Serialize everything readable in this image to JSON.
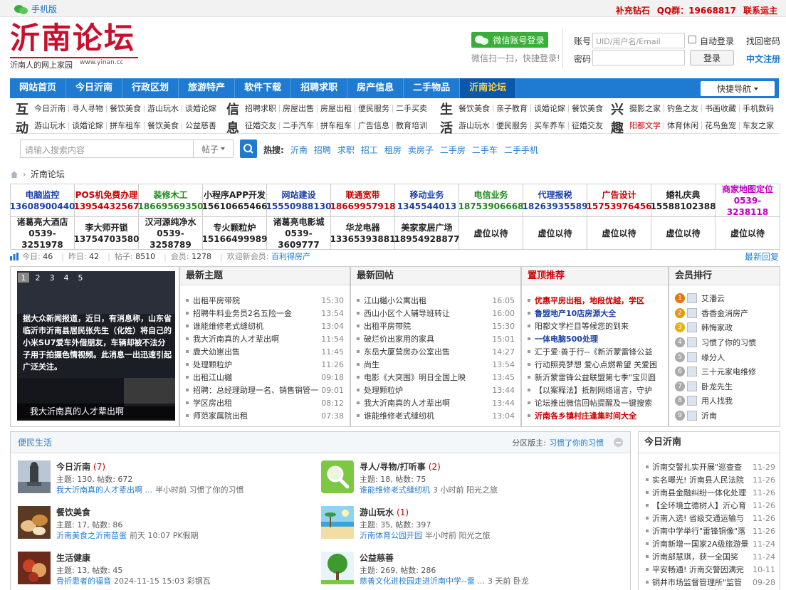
{
  "topbar": {
    "mobile": "手机版",
    "links": [
      "补充钻石",
      "QQ群：19668817",
      "联系运主"
    ]
  },
  "header": {
    "logo": "沂南论坛",
    "slogan": "沂南人的网上家园",
    "url": "www.yinan.cc",
    "wx_login": "微信账号登录",
    "wx_hint": "微信扫一扫，快捷登录!",
    "login": {
      "account_label": "账号",
      "account_placeholder": "UID/用户名/Email",
      "password_label": "密码",
      "auto_login": "自动登录",
      "forgot": "找回密码",
      "login_btn": "登录",
      "register": "中文注册"
    }
  },
  "mainnav": [
    "网站首页",
    "今日沂南",
    "行政区划",
    "旅游特产",
    "软件下载",
    "招聘求职",
    "房产信息",
    "二手物品",
    "沂南论坛"
  ],
  "quicknav": "快捷导航",
  "subnav": {
    "g1": {
      "big": [
        "互",
        "动"
      ],
      "rows": [
        [
          "今日沂南",
          "寻人寻物",
          "餐饮美食",
          "游山玩水",
          "谈婚论嫁"
        ],
        [
          "游山玩水",
          "谈婚论嫁",
          "拼车租车",
          "餐饮美食",
          "公益慈善"
        ]
      ]
    },
    "g2": {
      "big": [
        "信",
        "息"
      ],
      "rows": [
        [
          "招聘求职",
          "房屋出售",
          "房屋出租",
          "便民服务",
          "二手买卖"
        ],
        [
          "征婚交友",
          "二手汽车",
          "拼车租车",
          "广告信息",
          "教育培训"
        ]
      ]
    },
    "g3": {
      "big": [
        "生",
        "活"
      ],
      "rows": [
        [
          "餐饮美食",
          "亲子教育",
          "谈婚论嫁",
          "餐饮美食"
        ],
        [
          "游山玩水",
          "便民服务",
          "买车养车",
          "征婚交友"
        ]
      ]
    },
    "g4": {
      "big": [
        "兴",
        "趣"
      ],
      "rows": [
        [
          "摄影之家",
          "钓鱼之友",
          "书画收藏",
          "手机数码"
        ],
        [
          "阳都文学",
          "体育休闲",
          "花鸟鱼宠",
          "车友之家"
        ]
      ]
    }
  },
  "search": {
    "placeholder": "请输入搜索内容",
    "type": "帖子",
    "hot_label": "热搜:",
    "hot": [
      "沂南",
      "招聘",
      "求职",
      "招工",
      "租房",
      "卖房子",
      "二手房",
      "二手车",
      "二手手机"
    ]
  },
  "breadcrumb": "沂南论坛",
  "ads": [
    [
      {
        "name": "电脑监控",
        "phone": "13608900440",
        "c": "#1a3fa8"
      },
      {
        "name": "POS机免费办理",
        "phone": "13954432567",
        "c": "#c00"
      },
      {
        "name": "装修木工",
        "phone": "18669569350",
        "c": "#1a8a1a"
      },
      {
        "name": "小程序APP开发",
        "phone": "15610665466",
        "c": "#222"
      },
      {
        "name": "网站建设",
        "phone": "15550988130",
        "c": "#1a3fa8"
      },
      {
        "name": "联通宽带",
        "phone": "18669957918",
        "c": "#c00"
      },
      {
        "name": "移动业务",
        "phone": "1345544013",
        "c": "#1a3fa8"
      },
      {
        "name": "电信业务",
        "phone": "18753906668",
        "c": "#1a8a1a"
      },
      {
        "name": "代理报税",
        "phone": "18263935589",
        "c": "#1a3fa8"
      },
      {
        "name": "广告设计",
        "phone": "15753976456",
        "c": "#c00"
      },
      {
        "name": "婚礼庆典",
        "phone": "15588102388",
        "c": "#222"
      },
      {
        "name": "商家地图定位",
        "phone": "0539-3238118",
        "c": "#c000c0"
      }
    ],
    [
      {
        "name": "诸葛亮大酒店",
        "phone": "0539-3251978",
        "c": "#222"
      },
      {
        "name": "李大师开锁",
        "phone": "13754703580",
        "c": "#222"
      },
      {
        "name": "汉河源纯净水",
        "phone": "0539-3258789",
        "c": "#222"
      },
      {
        "name": "专火颗粒炉",
        "phone": "15166499989",
        "c": "#222"
      },
      {
        "name": "诸葛亮电影城",
        "phone": "0539-3609777",
        "c": "#222"
      },
      {
        "name": "华龙电器",
        "phone": "13365393881",
        "c": "#222"
      },
      {
        "name": "美家家居广场",
        "phone": "18954928877",
        "c": "#222"
      },
      {
        "name": "虚位以待",
        "phone": "",
        "c": "#222"
      },
      {
        "name": "虚位以待",
        "phone": "",
        "c": "#222"
      },
      {
        "name": "虚位以待",
        "phone": "",
        "c": "#222"
      },
      {
        "name": "虚位以待",
        "phone": "",
        "c": "#222"
      },
      {
        "name": "虚位以待",
        "phone": "",
        "c": "#222"
      }
    ]
  ],
  "stats": {
    "today_l": "今日:",
    "today": "46",
    "yest_l": "昨日:",
    "yest": "42",
    "posts_l": "帖子:",
    "posts": "8510",
    "members_l": "会员:",
    "members": "1278",
    "welcome": "欢迎新会员:",
    "newmember": "百利得房产",
    "latest": "最新回复"
  },
  "slideshow": {
    "nums": [
      "1",
      "2",
      "3",
      "4",
      "5"
    ],
    "text": "据大众新闻报道，近日，有消息称，山东省临沂市沂南县居民张先生（化姓）将自己的小米SU7爱车外借朋友，车辆却被不法分子用于拍摄色情视频。此消息一出迅速引起广泛关注。",
    "caption": "我大沂南真的人才辈出啊"
  },
  "latest_topics": {
    "title": "最新主题",
    "items": [
      [
        "出租平房带院",
        "15:30"
      ],
      [
        "招聘牛料业务员2名五险一金",
        "13:54"
      ],
      [
        "谁能维修老式缝纫机",
        "13:04"
      ],
      [
        "我大沂南真的人才辈出啊",
        "11:54"
      ],
      [
        "鹿犬幼崽出售",
        "11:45"
      ],
      [
        "处理颗粒炉",
        "11:26"
      ],
      [
        "出租江山樾",
        "09:18"
      ],
      [
        "招聘：总经理助理一名、销售销管一",
        "09:01"
      ],
      [
        "学区房出租",
        "08:12"
      ],
      [
        "师范家属院出租",
        "07:38"
      ]
    ]
  },
  "latest_replies": {
    "title": "最新回帖",
    "items": [
      [
        "江山樾小公寓出租",
        "16:05"
      ],
      [
        "西山小区个人辅导班转让",
        "16:00"
      ],
      [
        "出租平房带院",
        "15:30"
      ],
      [
        "破烂价出家用的家具",
        "15:01"
      ],
      [
        "东岳大厦营房办公室出售",
        "14:27"
      ],
      [
        "尚生",
        "13:54"
      ],
      [
        "电影《大突围》明日全国上映",
        "13:45"
      ],
      [
        "处理颗粒炉",
        "13:44"
      ],
      [
        "我大沂南真的人才辈出啊",
        "13:44"
      ],
      [
        "谁能维修老式缝纫机",
        "13:04"
      ]
    ]
  },
  "pinned": {
    "title": "置顶推荐",
    "items": [
      {
        "t": "优惠平房出租，地段优越，学区",
        "c": "#c00",
        "b": true
      },
      {
        "t": "鲁盟地产10店房源大全",
        "c": "#1a3fa8",
        "b": true
      },
      {
        "t": "阳都文学栏目等候您的到来",
        "c": "#333",
        "b": false
      },
      {
        "t": "一体电脑500处理",
        "c": "#1a3fa8",
        "b": true
      },
      {
        "t": "汇于爱·善于行--《新沂蒙雷锋公益",
        "c": "#333",
        "b": false
      },
      {
        "t": "行动照亮梦想 爱心点燃希望 关爱困",
        "c": "#333",
        "b": false
      },
      {
        "t": "新沂蒙雷锋公益联盟第七季\"宝贝圆",
        "c": "#333",
        "b": false
      },
      {
        "t": "【以案释法】抵制网络谣言，守护",
        "c": "#333",
        "b": false
      },
      {
        "t": "论坛推出微信回帖提醒及一键搜索",
        "c": "#333",
        "b": false
      },
      {
        "t": "沂南各乡镇村庄逢集时间大全",
        "c": "#c00",
        "b": true
      }
    ]
  },
  "ranking": {
    "title": "会员排行",
    "items": [
      {
        "n": "1",
        "name": "艾潘云",
        "c": "#e8760c"
      },
      {
        "n": "2",
        "name": "香香金消房产",
        "c": "#e8960c"
      },
      {
        "n": "3",
        "name": "韩悔家政",
        "c": "#e8b00c"
      },
      {
        "n": "4",
        "name": "习惯了你的习惯",
        "c": "#aaa"
      },
      {
        "n": "5",
        "name": "缘分人",
        "c": "#aaa"
      },
      {
        "n": "6",
        "name": "三十元家电维修",
        "c": "#aaa"
      },
      {
        "n": "7",
        "name": "卧龙先生",
        "c": "#aaa"
      },
      {
        "n": "8",
        "name": "用人找我",
        "c": "#aaa"
      },
      {
        "n": "9",
        "name": "沂南",
        "c": "#aaa"
      }
    ]
  },
  "forum": {
    "title": "便民生活",
    "moderator_label": "分区版主:",
    "moderator": "习惯了你的习惯",
    "items": [
      {
        "name": "今日沂南",
        "new": "(7)",
        "stat": "主题: 130, 帖数: 672",
        "last": "我大沂南真的人才辈出啊 ...",
        "time": "半小时前 习惯了你的习惯",
        "ico": "statue"
      },
      {
        "name": "寻人/寻物/打听事",
        "new": "(2)",
        "stat": "主题: 18, 帖数: 75",
        "last": "谁能维修老式缝纫机",
        "time": "3 小时前 阳光之旅",
        "ico": "search"
      },
      {
        "name": "餐饮美食",
        "new": "",
        "stat": "主题: 17, 帖数: 86",
        "last": "沂南美食之沂南苗蛋",
        "time": "前天 10:07 PK假期",
        "ico": "food"
      },
      {
        "name": "游山玩水",
        "new": "(1)",
        "stat": "主题: 35, 帖数: 397",
        "last": "沂南体育公园开园",
        "time": "半小时前 阳光之旅",
        "ico": "beach"
      },
      {
        "name": "生活健康",
        "new": "",
        "stat": "主题: 13, 帖数: 45",
        "last": "骨折患者的福音",
        "time": "2024-11-15 15:03 彩钢瓦",
        "ico": "health"
      },
      {
        "name": "公益慈善",
        "new": "",
        "stat": "主题: 269, 帖数: 286",
        "last": "慈善文化进校园走进沂南中学--雷 ...",
        "time": "3 天前 卧龙",
        "ico": "tree"
      }
    ]
  },
  "today": {
    "title": "今日沂南",
    "items": [
      [
        "沂南交警扎实开展\"巡查查",
        "11-29"
      ],
      [
        "实名曝光! 沂南县人民法院",
        "11-26"
      ],
      [
        "沂南县金融纠纷一体化处理",
        "11-26"
      ],
      [
        "【全环境立德树人】沂心育",
        "11-26"
      ],
      [
        "沂南入选! 省级交通运输与",
        "11-26"
      ],
      [
        "沂南中学举行\"雷锋铜像\"落",
        "11-26"
      ],
      [
        "沂南新增一国家2A级旅游景",
        "11-24"
      ],
      [
        "沂南部慧琪，获一全国奖",
        "11-24"
      ],
      [
        "平安畅通! 沂南交警因满完",
        "10-11"
      ],
      [
        "铜井市场监督管理所\"监管",
        "09-28"
      ]
    ]
  }
}
